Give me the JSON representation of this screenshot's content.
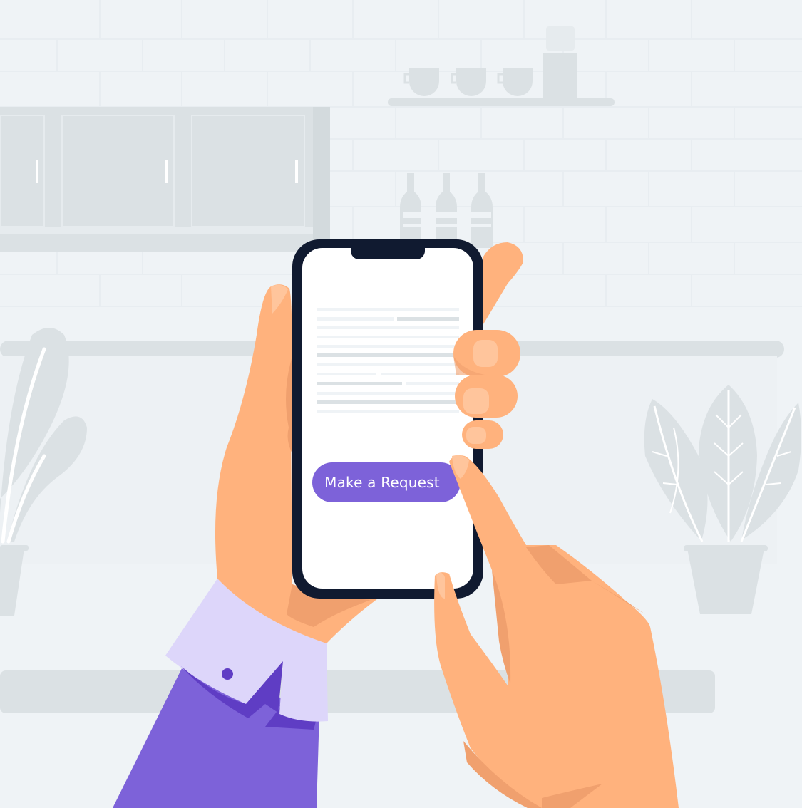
{
  "app": {
    "primary_action_label": "Make a Request"
  },
  "colors": {
    "background": "#eff3f6",
    "furniture": "#dbe1e4",
    "phone_frame": "#101a30",
    "screen": "#ffffff",
    "accent": "#7d62d9",
    "cuff": "#ddd6fa",
    "skin": "#ffb27d",
    "skin_shadow": "#f0a06e"
  },
  "icons": [
    "hand-icon",
    "phone-icon",
    "plant-icon",
    "mug-icon",
    "bottle-icon"
  ]
}
